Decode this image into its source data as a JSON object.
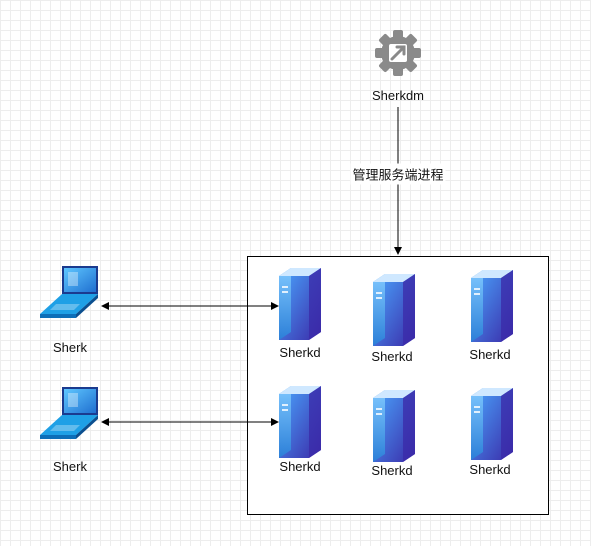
{
  "manager": {
    "label": "Sherkdm",
    "icon": "gear-icon"
  },
  "manager_edge_label": "管理服务端进程",
  "clients": [
    {
      "label": "Sherk",
      "icon": "laptop-icon"
    },
    {
      "label": "Sherk",
      "icon": "laptop-icon"
    }
  ],
  "servers": [
    {
      "label": "Sherkd",
      "icon": "server-icon"
    },
    {
      "label": "Sherkd",
      "icon": "server-icon"
    },
    {
      "label": "Sherkd",
      "icon": "server-icon"
    },
    {
      "label": "Sherkd",
      "icon": "server-icon"
    },
    {
      "label": "Sherkd",
      "icon": "server-icon"
    },
    {
      "label": "Sherkd",
      "icon": "server-icon"
    }
  ],
  "colors": {
    "server_dark": "#3b2aa8",
    "server_light": "#4aa8ff",
    "laptop_blue": "#1fa0e6",
    "gear_gray": "#8a8a8a"
  }
}
